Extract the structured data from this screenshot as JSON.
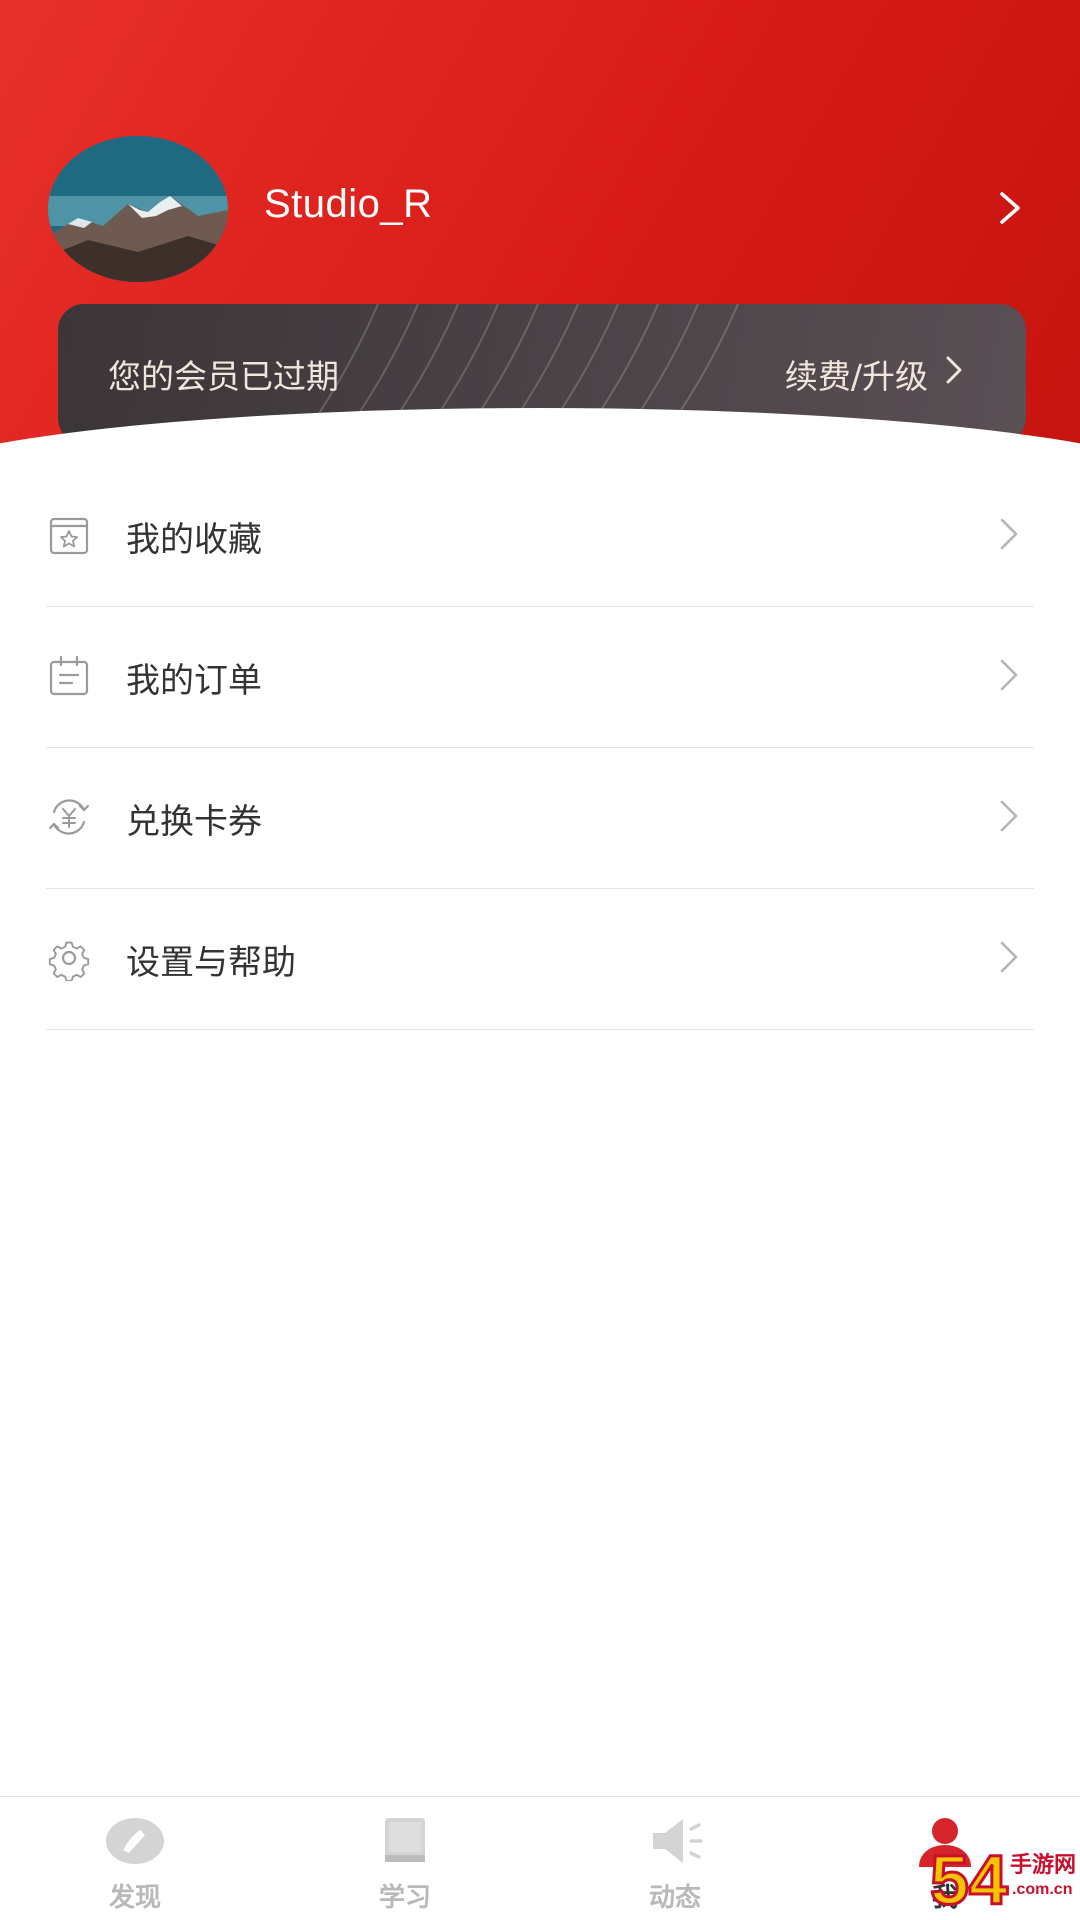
{
  "profile": {
    "username": "Studio_R"
  },
  "membership": {
    "status_text": "您的会员已过期",
    "renew_label": "续费/升级"
  },
  "menu": [
    {
      "label": "我的收藏",
      "icon": "favorites-icon"
    },
    {
      "label": "我的订单",
      "icon": "orders-icon"
    },
    {
      "label": "兑换卡券",
      "icon": "coupon-exchange-icon"
    },
    {
      "label": "设置与帮助",
      "icon": "settings-icon"
    }
  ],
  "bottom_nav": [
    {
      "label": "发现",
      "icon": "discover-icon",
      "active": false
    },
    {
      "label": "学习",
      "icon": "book-icon",
      "active": false
    },
    {
      "label": "动态",
      "icon": "speaker-icon",
      "active": false
    },
    {
      "label": "我",
      "icon": "user-icon",
      "active": true
    }
  ],
  "watermark": {
    "text_large": "54",
    "text_small_top": "手游网",
    "text_small_bottom": ".com.cn"
  },
  "colors": {
    "header_red": "#d81b17",
    "card_dark": "#463f42",
    "card_text": "#f1e6dc",
    "active_nav": "#d6252a",
    "inactive_nav": "#b9b9b9"
  }
}
